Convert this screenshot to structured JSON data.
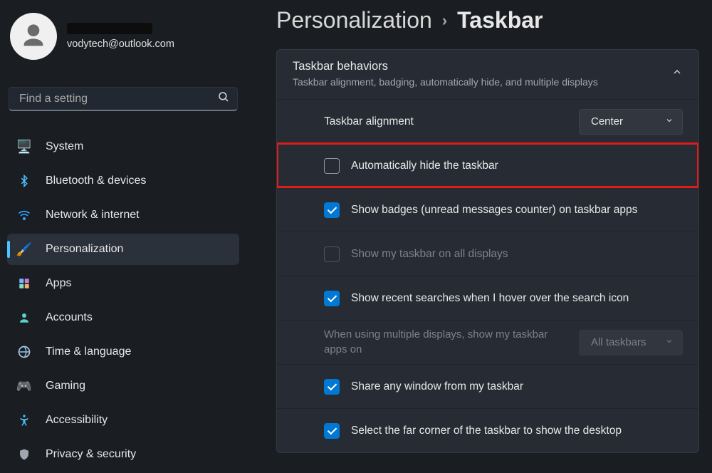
{
  "user": {
    "email": "vodytech@outlook.com"
  },
  "search": {
    "placeholder": "Find a setting"
  },
  "nav": {
    "items": [
      {
        "label": "System"
      },
      {
        "label": "Bluetooth & devices"
      },
      {
        "label": "Network & internet"
      },
      {
        "label": "Personalization"
      },
      {
        "label": "Apps"
      },
      {
        "label": "Accounts"
      },
      {
        "label": "Time & language"
      },
      {
        "label": "Gaming"
      },
      {
        "label": "Accessibility"
      },
      {
        "label": "Privacy & security"
      }
    ],
    "selected_index": 3
  },
  "breadcrumb": {
    "parent": "Personalization",
    "current": "Taskbar"
  },
  "panel": {
    "title": "Taskbar behaviors",
    "subtitle": "Taskbar alignment, badging, automatically hide, and multiple displays",
    "alignment": {
      "label": "Taskbar alignment",
      "value": "Center"
    },
    "options": [
      {
        "label": "Automatically hide the taskbar",
        "checked": false,
        "disabled": false,
        "highlighted": true
      },
      {
        "label": "Show badges (unread messages counter) on taskbar apps",
        "checked": true,
        "disabled": false
      },
      {
        "label": "Show my taskbar on all displays",
        "checked": false,
        "disabled": true
      },
      {
        "label": "Show recent searches when I hover over the search icon",
        "checked": true,
        "disabled": false
      }
    ],
    "multi_display": {
      "label": "When using multiple displays, show my taskbar apps on",
      "value": "All taskbars",
      "disabled": true
    },
    "options_after": [
      {
        "label": "Share any window from my taskbar",
        "checked": true
      },
      {
        "label": "Select the far corner of the taskbar to show the desktop",
        "checked": true
      }
    ]
  }
}
